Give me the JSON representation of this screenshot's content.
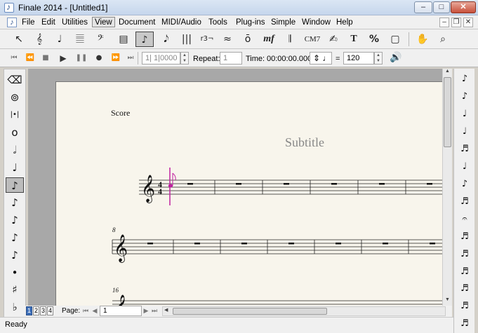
{
  "window": {
    "title": "Finale 2014 - [Untitled1]",
    "minimize": "–",
    "maximize": "□",
    "close": "✕"
  },
  "menu": {
    "items": [
      "File",
      "Edit",
      "Utilities",
      "View",
      "Document",
      "MIDI/Audio",
      "Tools",
      "Plug-ins",
      "Simple",
      "Window",
      "Help"
    ],
    "active": "View",
    "mdi": [
      "–",
      "❐",
      "✕"
    ]
  },
  "tools": {
    "labels": [
      "↖",
      "𝄞",
      "♩",
      "𝄚",
      "𝄢",
      "▤",
      "♪",
      "♪",
      "|||",
      "r3¬",
      "≈",
      "ō",
      "mf",
      "𝄂",
      "CM7",
      "♨",
      "T",
      "%",
      "▢",
      "✋",
      "🔍"
    ],
    "selected_index": 6,
    "chord_label": "CM7",
    "dynamic_label": "mf",
    "text_label": "T",
    "percent_label": "%"
  },
  "playback": {
    "measure_field": "1| 1|0000",
    "repeat_label": "Repeat:",
    "repeat_value": "1",
    "time_label": "Time:",
    "time_value": "00:00:00.000",
    "equals": "=",
    "tempo_value": "120"
  },
  "left_palette": {
    "icons": [
      "eraser-icon",
      "tie-icon",
      "whole-rest-icon",
      "whole-note-icon",
      "half-note-icon",
      "quarter-note-icon",
      "eighth-note-icon",
      "sixteenth-note-icon",
      "thirty-second-note-icon",
      "sixty-fourth-note-icon",
      "128th-note-icon",
      "dot-icon",
      "sharp-icon",
      "flat-icon"
    ],
    "glyphs": [
      "⌫",
      "⊚",
      "|•|",
      "o",
      "𝅗𝅥",
      "♩",
      "♪",
      "♪",
      "♪",
      "♪",
      "♪",
      "•",
      "♯",
      "♭"
    ],
    "selected_index": 6
  },
  "right_palette": {
    "glyphs": [
      "♪",
      "♪",
      "♩",
      "♩",
      "♬",
      "♩",
      "♪",
      "♬",
      "𝄐",
      "♬",
      "♬",
      "♬",
      "♬",
      "♬",
      "♬"
    ]
  },
  "score": {
    "part_label": "Score",
    "subtitle": "Subtitle",
    "time_signature_top": "4",
    "time_signature_bottom": "4",
    "measure_numbers": [
      "8",
      "16"
    ]
  },
  "navigation": {
    "views": [
      "1",
      "2",
      "3",
      "4"
    ],
    "active_view": "1",
    "page_label": "Page:",
    "page_value": "1"
  },
  "status": {
    "text": "Ready"
  },
  "colors": {
    "selected_note": "#c020a0",
    "page_background": "#f8f5ec",
    "subtitle_gray": "#888888"
  }
}
